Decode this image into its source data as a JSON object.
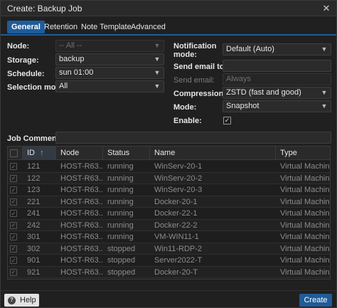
{
  "window": {
    "title": "Create: Backup Job",
    "close_glyph": "✕"
  },
  "tabs": [
    {
      "label": "General"
    },
    {
      "label": "Retention"
    },
    {
      "label": "Note Template"
    },
    {
      "label": "Advanced"
    }
  ],
  "form": {
    "node": {
      "label": "Node:",
      "value": "-- All --"
    },
    "storage": {
      "label": "Storage:",
      "value": "backup"
    },
    "schedule": {
      "label": "Schedule:",
      "value": "sun 01:00"
    },
    "selection_mode": {
      "label": "Selection mode:",
      "value": "All"
    },
    "notification_mode": {
      "label_line1": "Notification",
      "label_line2": "mode:",
      "value": "Default (Auto)"
    },
    "send_email_to": {
      "label": "Send email to:",
      "value": ""
    },
    "send_email": {
      "label": "Send email:",
      "value": "Always"
    },
    "compression": {
      "label": "Compression:",
      "value": "ZSTD (fast and good)"
    },
    "mode": {
      "label": "Mode:",
      "value": "Snapshot"
    },
    "enable": {
      "label": "Enable:",
      "checked": true,
      "check_glyph": "✓"
    },
    "job_comment": {
      "label": "Job Comment:",
      "value": ""
    }
  },
  "grid": {
    "columns": [
      "ID",
      "Node",
      "Status",
      "Name",
      "Type"
    ],
    "sort_glyph": "↑",
    "check_glyph": "✓",
    "rows": [
      {
        "id": "121",
        "node": "HOST-R63...",
        "status": "running",
        "name": "WinServ-20-1",
        "type": "Virtual Machine"
      },
      {
        "id": "122",
        "node": "HOST-R63...",
        "status": "running",
        "name": "WinServ-20-2",
        "type": "Virtual Machine"
      },
      {
        "id": "123",
        "node": "HOST-R63...",
        "status": "running",
        "name": "WinServ-20-3",
        "type": "Virtual Machine"
      },
      {
        "id": "221",
        "node": "HOST-R63...",
        "status": "running",
        "name": "Docker-20-1",
        "type": "Virtual Machine"
      },
      {
        "id": "241",
        "node": "HOST-R63...",
        "status": "running",
        "name": "Docker-22-1",
        "type": "Virtual Machine"
      },
      {
        "id": "242",
        "node": "HOST-R63...",
        "status": "running",
        "name": "Docker-22-2",
        "type": "Virtual Machine"
      },
      {
        "id": "301",
        "node": "HOST-R63...",
        "status": "running",
        "name": "VM-WIN11-1",
        "type": "Virtual Machine"
      },
      {
        "id": "302",
        "node": "HOST-R63...",
        "status": "stopped",
        "name": "Win11-RDP-2",
        "type": "Virtual Machine"
      },
      {
        "id": "901",
        "node": "HOST-R63...",
        "status": "stopped",
        "name": "Server2022-T",
        "type": "Virtual Machine"
      },
      {
        "id": "921",
        "node": "HOST-R63...",
        "status": "stopped",
        "name": "Docker-20-T",
        "type": "Virtual Machine"
      }
    ]
  },
  "footer": {
    "help_label": "Help",
    "help_glyph": "?",
    "create_label": "Create"
  },
  "icons": {
    "close": "close-icon",
    "caret": "chevron-down-icon",
    "help": "question-circle-icon",
    "check": "check-icon"
  },
  "colors": {
    "accent": "#1f5c99",
    "background": "#202020",
    "text": "#e6e6e6",
    "muted": "#8c8c8c"
  }
}
